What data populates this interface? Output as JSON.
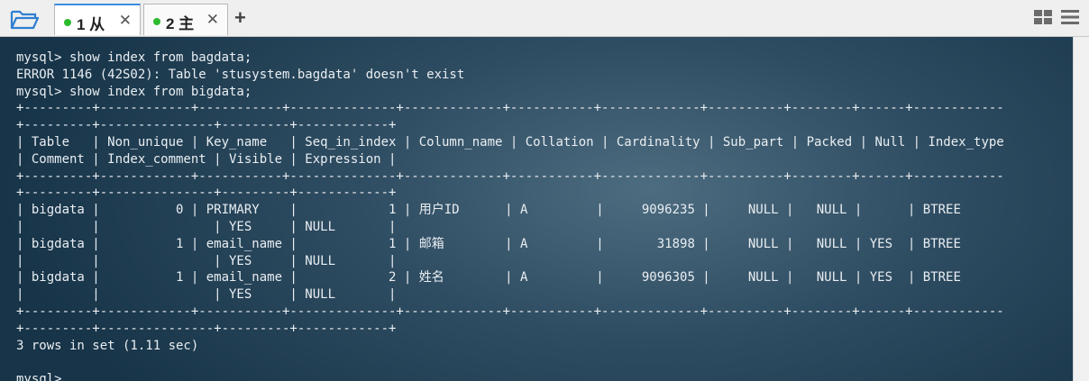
{
  "tabs": [
    {
      "label": "1 从",
      "close": "✕",
      "active": true
    },
    {
      "label": "2 主",
      "close": "✕",
      "active": false
    }
  ],
  "toolbar": {
    "new_tab": "+"
  },
  "terminal": {
    "lines": [
      "mysql> show index from bagdata;",
      "ERROR 1146 (42S02): Table 'stusystem.bagdata' doesn't exist",
      "mysql> show index from bigdata;",
      "+---------+------------+-----------+--------------+-------------+-----------+-------------+----------+--------+------+------------",
      "+---------+---------------+---------+------------+",
      "| Table   | Non_unique | Key_name   | Seq_in_index | Column_name | Collation | Cardinality | Sub_part | Packed | Null | Index_type",
      "| Comment | Index_comment | Visible | Expression |",
      "+---------+------------+-----------+--------------+-------------+-----------+-------------+----------+--------+------+------------",
      "+---------+---------------+---------+------------+",
      "| bigdata |          0 | PRIMARY    |            1 | 用户ID      | A         |     9096235 |     NULL |   NULL |      | BTREE",
      "|         |               | YES     | NULL       |",
      "| bigdata |          1 | email_name |            1 | 邮箱        | A         |       31898 |     NULL |   NULL | YES  | BTREE",
      "|         |               | YES     | NULL       |",
      "| bigdata |          1 | email_name |            2 | 姓名        | A         |     9096305 |     NULL |   NULL | YES  | BTREE",
      "|         |               | YES     | NULL       |",
      "+---------+------------+-----------+--------------+-------------+-----------+-------------+----------+--------+------+------------",
      "+---------+---------------+---------+------------+",
      "3 rows in set (1.11 sec)",
      "",
      "mysql>"
    ]
  },
  "colors": {
    "accent": "#3c8de0",
    "session_dot": "#2dbb2d",
    "terminal_text": "#e9eef2",
    "terminal_bg": "#2f4d62"
  }
}
